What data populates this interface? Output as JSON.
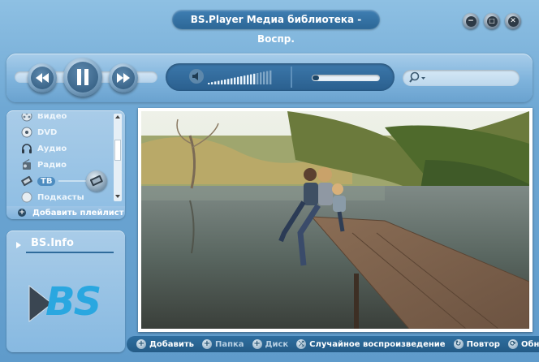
{
  "window": {
    "title": "BS.Player Медиа библиотека - Воспр.",
    "minimize_glyph": "−",
    "maximize_glyph": "□",
    "close_glyph": "✕"
  },
  "player": {
    "volume_level": 0.75,
    "progress_level": 0.1,
    "search_placeholder": ""
  },
  "library": {
    "items": [
      {
        "label": "Видео",
        "icon": "video-icon"
      },
      {
        "label": "DVD",
        "icon": "dvd-icon"
      },
      {
        "label": "Аудио",
        "icon": "headphones-icon"
      },
      {
        "label": "Радио",
        "icon": "radio-icon"
      },
      {
        "label": "ТВ",
        "icon": "tv-icon"
      },
      {
        "label": "Подкасты",
        "icon": "podcast-icon"
      }
    ],
    "add_playlist": "Добавить плейлист"
  },
  "info": {
    "title": "BS.Info",
    "logo_text": "BS"
  },
  "bottombar": {
    "add": "Добавить",
    "folder": "Папка",
    "disc": "Диск",
    "shuffle": "Случайное воспроизведение",
    "repeat": "Повтор",
    "refresh": "Обновить"
  },
  "colors": {
    "accent": "#2a6a9c",
    "logo_blue": "#2aa7e0"
  }
}
